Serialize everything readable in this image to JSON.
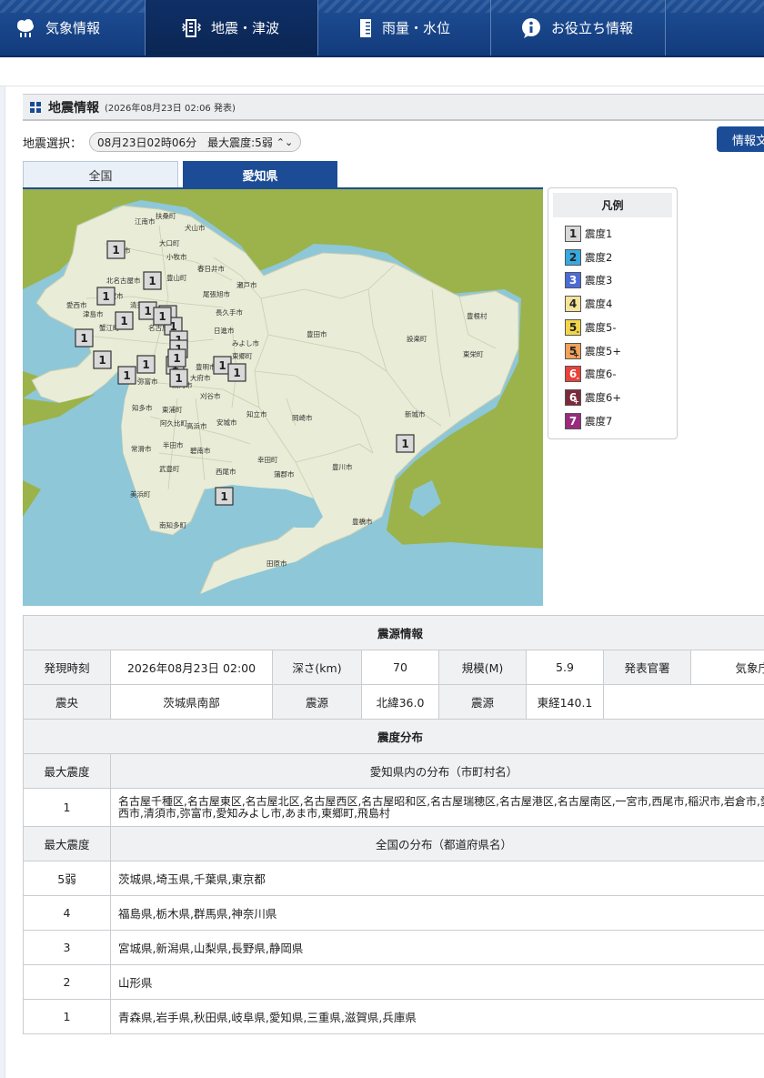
{
  "nav": {
    "items": [
      {
        "label": "気象情報",
        "icon": "cloud-rain-icon"
      },
      {
        "label": "地震・津波",
        "icon": "building-icon"
      },
      {
        "label": "雨量・水位",
        "icon": "gauge-icon"
      },
      {
        "label": "お役立ち情報",
        "icon": "info-icon"
      }
    ],
    "active_index": 1
  },
  "section": {
    "title": "地震情報",
    "date": "(2026年08月23日 02:06 発表)"
  },
  "quake_select": {
    "label": "地震選択：",
    "value": "08月23日02時06分　最大震度:5弱"
  },
  "report_button": "情報文",
  "tabs": [
    {
      "label": "全国"
    },
    {
      "label": "愛知県"
    }
  ],
  "active_tab": 1,
  "map": {
    "place_labels": [
      "扶桑町",
      "犬山市",
      "江南市",
      "大口町",
      "一宮市",
      "小牧市",
      "北名古屋市",
      "春日井市",
      "豊山町",
      "瀬戸市",
      "稲沢市",
      "清須市",
      "尾張旭市",
      "愛西市",
      "津島市",
      "長久手市",
      "名古屋市",
      "蟹江町",
      "日進市",
      "みよし市",
      "東郷町",
      "豊明市",
      "弥富市",
      "東海市",
      "大府市",
      "刈谷市",
      "知立市",
      "豊田市",
      "設楽町",
      "豊根村",
      "東栄町",
      "知多市",
      "東浦町",
      "安城市",
      "岡崎市",
      "阿久比町",
      "高浜市",
      "新城市",
      "常滑市",
      "半田市",
      "碧南市",
      "幸田町",
      "西尾市",
      "蒲郡市",
      "豊川市",
      "武豊町",
      "美浜町",
      "南知多町",
      "豊橋市",
      "田原市"
    ],
    "markers": [
      "1",
      "1",
      "1",
      "1",
      "1",
      "1",
      "1",
      "1",
      "1",
      "1",
      "1",
      "1",
      "1",
      "1",
      "1",
      "1",
      "1",
      "1",
      "1",
      "1",
      "1"
    ]
  },
  "legend": {
    "title": "凡例",
    "items": [
      {
        "label": "震度1",
        "glyph": "1",
        "mod": "",
        "color": "#d9d9d9",
        "fg": "#222"
      },
      {
        "label": "震度2",
        "glyph": "2",
        "mod": "",
        "color": "#36a9e0",
        "fg": "#222"
      },
      {
        "label": "震度3",
        "glyph": "3",
        "mod": "",
        "color": "#4d6bd6",
        "fg": "#fff"
      },
      {
        "label": "震度4",
        "glyph": "4",
        "mod": "",
        "color": "#f6e39b",
        "fg": "#222"
      },
      {
        "label": "震度5-",
        "glyph": "5",
        "mod": "-",
        "color": "#f1d54a",
        "fg": "#222"
      },
      {
        "label": "震度5+",
        "glyph": "5",
        "mod": "+",
        "color": "#f0a15a",
        "fg": "#222"
      },
      {
        "label": "震度6-",
        "glyph": "6",
        "mod": "-",
        "color": "#e8423a",
        "fg": "#fff"
      },
      {
        "label": "震度6+",
        "glyph": "6",
        "mod": "+",
        "color": "#7a2a3c",
        "fg": "#fff"
      },
      {
        "label": "震度7",
        "glyph": "7",
        "mod": "",
        "color": "#9a2a7e",
        "fg": "#fff"
      }
    ]
  },
  "source": {
    "heading": "震源情報",
    "row1": [
      "発現時刻",
      "2026年08月23日 02:00",
      "深さ(km)",
      "70",
      "規模(M)",
      "5.9",
      "発表官署",
      "気象庁"
    ],
    "row2": [
      "震央",
      "茨城県南部",
      "震源",
      "北緯36.0",
      "震源",
      "東経140.1"
    ]
  },
  "distribution": {
    "heading": "震度分布",
    "pref_header": [
      "最大震度",
      "愛知県内の分布（市町村名）"
    ],
    "pref_rows": [
      {
        "level": "1",
        "places": "名古屋千種区,名古屋東区,名古屋北区,名古屋西区,名古屋昭和区,名古屋瑞穂区,名古屋港区,名古屋南区,一宮市,西尾市,稲沢市,岩倉市,愛西市,清須市,弥富市,愛知みよし市,あま市,東郷町,飛島村"
      }
    ],
    "national_header": [
      "最大震度",
      "全国の分布（都道府県名）"
    ],
    "national_rows": [
      {
        "level": "5弱",
        "places": "茨城県,埼玉県,千葉県,東京都"
      },
      {
        "level": "4",
        "places": "福島県,栃木県,群馬県,神奈川県"
      },
      {
        "level": "3",
        "places": "宮城県,新潟県,山梨県,長野県,静岡県"
      },
      {
        "level": "2",
        "places": "山形県"
      },
      {
        "level": "1",
        "places": "青森県,岩手県,秋田県,岐阜県,愛知県,三重県,滋賀県,兵庫県"
      }
    ]
  },
  "colors": {
    "nav_bg": "#1a4a93",
    "accent": "#1c4c96",
    "land": "#e9ecd6",
    "sea": "#8ec7d8",
    "outside_land": "#9bb34a"
  }
}
